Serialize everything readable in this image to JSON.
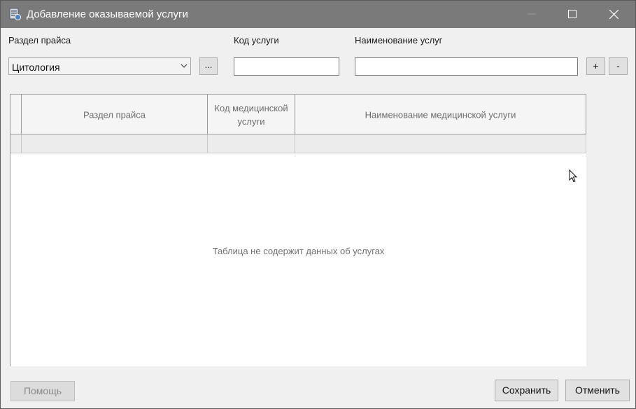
{
  "window": {
    "title": "Добавление оказываемой услуги"
  },
  "filters": {
    "price_section_label": "Раздел прайса",
    "price_section_value": "Цитология",
    "browse_label": "...",
    "service_code_label": "Код услуги",
    "service_code_value": "",
    "service_name_label": "Наименование услуг",
    "service_name_value": "",
    "add_label": "+",
    "remove_label": "-"
  },
  "table": {
    "columns": [
      "Раздел прайса",
      "Код медицинской услуги",
      "Наименование медицинской услуги"
    ],
    "rows": [],
    "empty_message": "Таблица не содержит данных об услугах"
  },
  "footer": {
    "help_label": "Помощь",
    "save_label": "Сохранить",
    "cancel_label": "Отменить"
  },
  "colors": {
    "titlebar": "#7a7a7a",
    "background": "#f0f0f0"
  }
}
